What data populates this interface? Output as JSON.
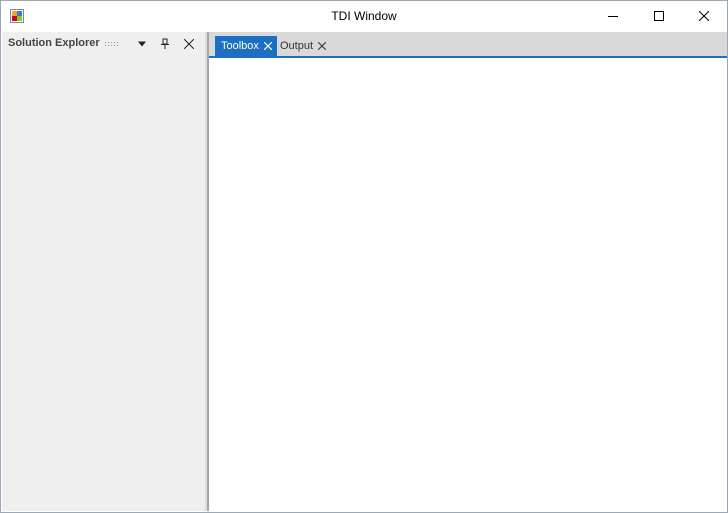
{
  "window": {
    "title": "TDI Window",
    "icon": "app-window-icon",
    "controls": [
      "minimize-icon",
      "maximize-icon",
      "close-icon"
    ]
  },
  "explorer": {
    "title": "Solution Explorer",
    "icons": [
      "dropdown-arrow-icon",
      "pin-icon",
      "close-icon"
    ]
  },
  "tabs": [
    {
      "label": "Toolbox",
      "active": true
    },
    {
      "label": "Output",
      "active": false
    }
  ],
  "colors": {
    "accent": "#1c6fc1",
    "pane_background": "#efefef",
    "tabstrip_background": "#d9d9d9"
  }
}
